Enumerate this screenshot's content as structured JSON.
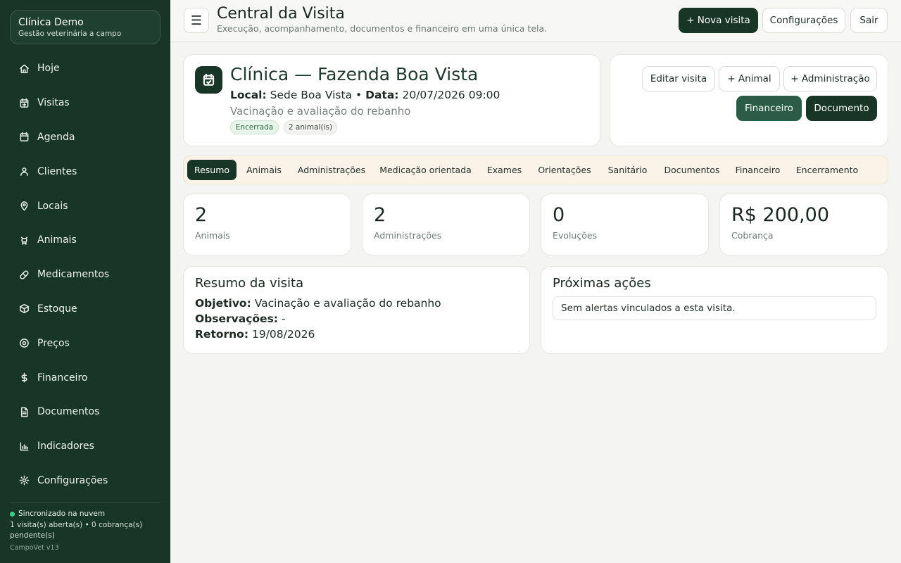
{
  "sidebar": {
    "brand_name": "Clínica Demo",
    "brand_sub": "Gestão veterinária a campo",
    "items": [
      {
        "label": "Hoje",
        "icon": "home-icon"
      },
      {
        "label": "Visitas",
        "icon": "calendar-plus-icon"
      },
      {
        "label": "Agenda",
        "icon": "calendar-icon"
      },
      {
        "label": "Clientes",
        "icon": "user-icon"
      },
      {
        "label": "Locais",
        "icon": "map-pin-icon"
      },
      {
        "label": "Animais",
        "icon": "cow-icon"
      },
      {
        "label": "Medicamentos",
        "icon": "pill-icon"
      },
      {
        "label": "Estoque",
        "icon": "box-icon"
      },
      {
        "label": "Preços",
        "icon": "tag-icon"
      },
      {
        "label": "Financeiro",
        "icon": "dollar-icon"
      },
      {
        "label": "Documentos",
        "icon": "document-icon"
      },
      {
        "label": "Indicadores",
        "icon": "bar-chart-icon"
      },
      {
        "label": "Configurações",
        "icon": "gear-icon"
      }
    ],
    "sync_status": "Sincronizado na nuvem",
    "sync_summary": "1 visita(s) aberta(s) • 0 cobrança(s) pendente(s)",
    "version": "CampoVet v13",
    "sync_color": "#39d17c"
  },
  "header": {
    "menu_icon": "☰",
    "title": "Central da Visita",
    "subtitle": "Execução, acompanhamento, documentos e financeiro em uma única tela.",
    "new_visit": "+ Nova visita",
    "settings": "Configurações",
    "logout": "Sair"
  },
  "visit": {
    "title": "Clínica — Fazenda Boa Vista",
    "local_label": "Local:",
    "local_value": "Sede Boa Vista",
    "separator": "•",
    "date_label": "Data:",
    "date_value": "20/07/2026 09:00",
    "description": "Vacinação e avaliação do rebanho",
    "status_badge": "Encerrada",
    "animals_badge": "2 animal(is)"
  },
  "actions": {
    "edit": "Editar visita",
    "add_animal": "+ Animal",
    "add_admin": "+ Administração",
    "financial": "Financeiro",
    "document": "Documento"
  },
  "tabs": [
    "Resumo",
    "Animais",
    "Administrações",
    "Medicação orientada",
    "Exames",
    "Orientações",
    "Sanitário",
    "Documentos",
    "Financeiro",
    "Encerramento"
  ],
  "active_tab": "Resumo",
  "stats": [
    {
      "value": "2",
      "label": "Animais"
    },
    {
      "value": "2",
      "label": "Administrações"
    },
    {
      "value": "0",
      "label": "Evoluções"
    },
    {
      "value": "R$ 200,00",
      "label": "Cobrança"
    }
  ],
  "summary": {
    "title": "Resumo da visita",
    "objective_label": "Objetivo:",
    "objective_value": "Vacinação e avaliação do rebanho",
    "notes_label": "Observações:",
    "notes_value": "-",
    "return_label": "Retorno:",
    "return_value": "19/08/2026"
  },
  "next_actions": {
    "title": "Próximas ações",
    "empty_message": "Sem alertas vinculados a esta visita."
  },
  "colors": {
    "primary": "#173628",
    "secondary": "#2a5c47",
    "tabs_bg": "#fbf3e7"
  }
}
